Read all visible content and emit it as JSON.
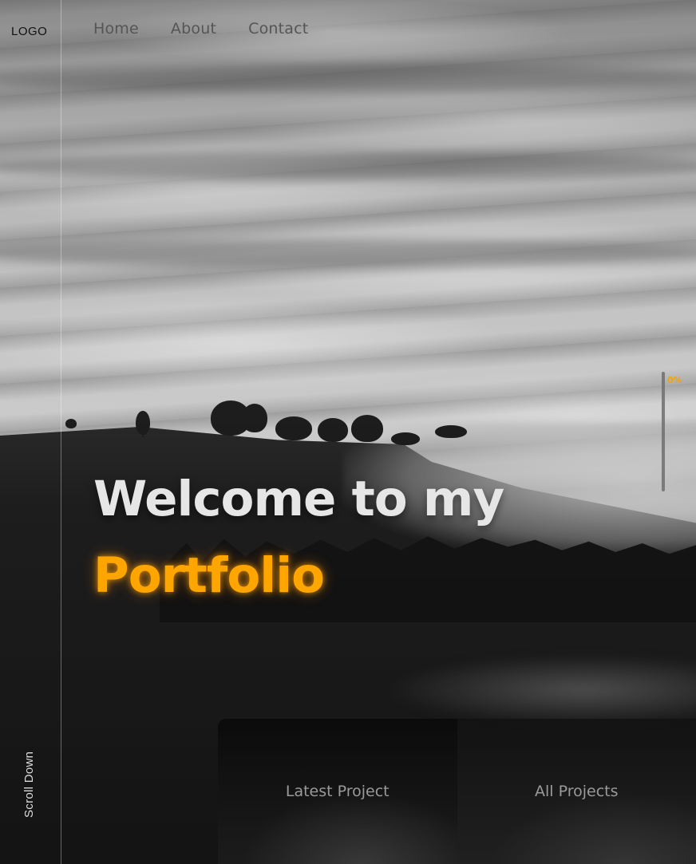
{
  "logo": {
    "text": "LOGO"
  },
  "nav": {
    "items": [
      {
        "label": "Home"
      },
      {
        "label": "About"
      },
      {
        "label": "Contact"
      }
    ]
  },
  "scroll_indicator": {
    "label": "0%",
    "progress": 0,
    "color": "#f5a300"
  },
  "hero": {
    "line1": "Welcome to my",
    "line2": "Portfolio",
    "accent_color": "#ffa500"
  },
  "sidebar": {
    "scroll_label": "Scroll Down"
  },
  "cards": {
    "latest_label": "Latest Project",
    "all_label": "All Projects"
  }
}
